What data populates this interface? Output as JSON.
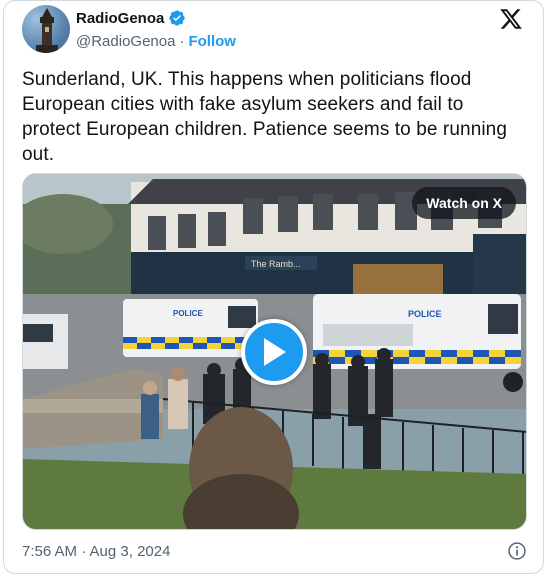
{
  "author": {
    "display_name": "RadioGenoa",
    "handle": "@RadioGenoa",
    "separator": "·",
    "follow_label": "Follow"
  },
  "tweet": {
    "text": "Sunderland, UK. This happens when politicians flood European cities with fake asylum seekers and fail to protect European children. Patience seems to be running out.",
    "timestamp": "7:56 AM · Aug 3, 2024"
  },
  "media": {
    "watch_label": "Watch on X",
    "scene_signs": {
      "van_left": "POLICE",
      "van_right": "POLICE",
      "pub_sign": "The Ramb..."
    }
  },
  "icons": {
    "verified": "verified-badge-icon",
    "brand": "x-logo-icon",
    "play": "play-icon",
    "info": "info-icon"
  },
  "colors": {
    "accent": "#1d9bf0",
    "text_primary": "#0f1419",
    "text_secondary": "#536471",
    "border": "#cfd9de"
  }
}
